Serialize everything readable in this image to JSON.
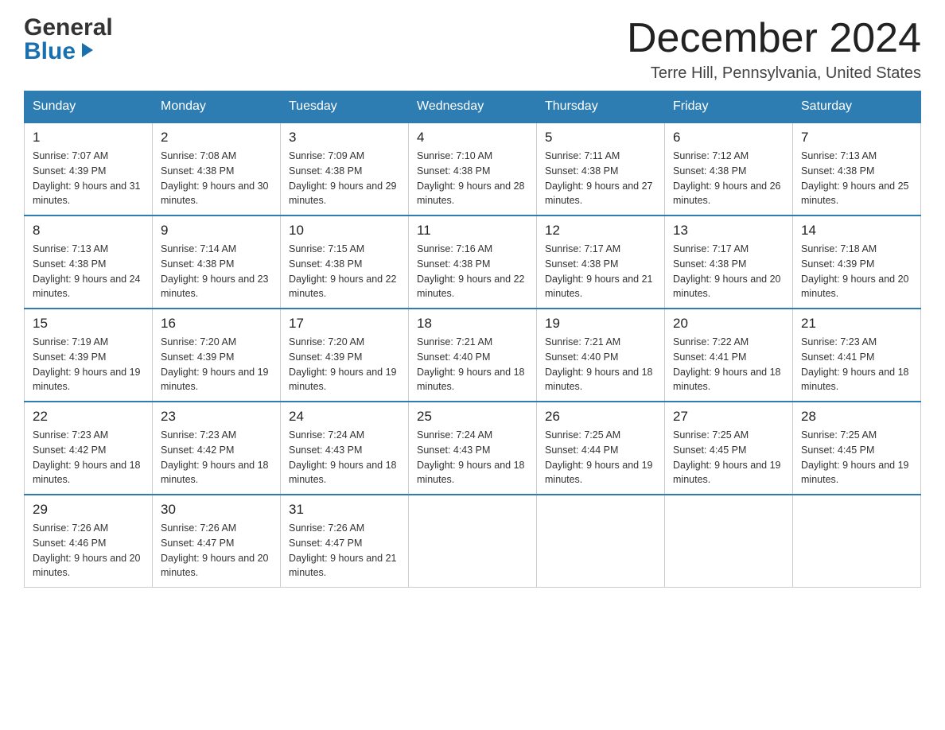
{
  "header": {
    "logo_line1": "General",
    "logo_line2": "Blue",
    "month_title": "December 2024",
    "location": "Terre Hill, Pennsylvania, United States"
  },
  "weekdays": [
    "Sunday",
    "Monday",
    "Tuesday",
    "Wednesday",
    "Thursday",
    "Friday",
    "Saturday"
  ],
  "weeks": [
    [
      {
        "day": "1",
        "sunrise": "Sunrise: 7:07 AM",
        "sunset": "Sunset: 4:39 PM",
        "daylight": "Daylight: 9 hours and 31 minutes."
      },
      {
        "day": "2",
        "sunrise": "Sunrise: 7:08 AM",
        "sunset": "Sunset: 4:38 PM",
        "daylight": "Daylight: 9 hours and 30 minutes."
      },
      {
        "day": "3",
        "sunrise": "Sunrise: 7:09 AM",
        "sunset": "Sunset: 4:38 PM",
        "daylight": "Daylight: 9 hours and 29 minutes."
      },
      {
        "day": "4",
        "sunrise": "Sunrise: 7:10 AM",
        "sunset": "Sunset: 4:38 PM",
        "daylight": "Daylight: 9 hours and 28 minutes."
      },
      {
        "day": "5",
        "sunrise": "Sunrise: 7:11 AM",
        "sunset": "Sunset: 4:38 PM",
        "daylight": "Daylight: 9 hours and 27 minutes."
      },
      {
        "day": "6",
        "sunrise": "Sunrise: 7:12 AM",
        "sunset": "Sunset: 4:38 PM",
        "daylight": "Daylight: 9 hours and 26 minutes."
      },
      {
        "day": "7",
        "sunrise": "Sunrise: 7:13 AM",
        "sunset": "Sunset: 4:38 PM",
        "daylight": "Daylight: 9 hours and 25 minutes."
      }
    ],
    [
      {
        "day": "8",
        "sunrise": "Sunrise: 7:13 AM",
        "sunset": "Sunset: 4:38 PM",
        "daylight": "Daylight: 9 hours and 24 minutes."
      },
      {
        "day": "9",
        "sunrise": "Sunrise: 7:14 AM",
        "sunset": "Sunset: 4:38 PM",
        "daylight": "Daylight: 9 hours and 23 minutes."
      },
      {
        "day": "10",
        "sunrise": "Sunrise: 7:15 AM",
        "sunset": "Sunset: 4:38 PM",
        "daylight": "Daylight: 9 hours and 22 minutes."
      },
      {
        "day": "11",
        "sunrise": "Sunrise: 7:16 AM",
        "sunset": "Sunset: 4:38 PM",
        "daylight": "Daylight: 9 hours and 22 minutes."
      },
      {
        "day": "12",
        "sunrise": "Sunrise: 7:17 AM",
        "sunset": "Sunset: 4:38 PM",
        "daylight": "Daylight: 9 hours and 21 minutes."
      },
      {
        "day": "13",
        "sunrise": "Sunrise: 7:17 AM",
        "sunset": "Sunset: 4:38 PM",
        "daylight": "Daylight: 9 hours and 20 minutes."
      },
      {
        "day": "14",
        "sunrise": "Sunrise: 7:18 AM",
        "sunset": "Sunset: 4:39 PM",
        "daylight": "Daylight: 9 hours and 20 minutes."
      }
    ],
    [
      {
        "day": "15",
        "sunrise": "Sunrise: 7:19 AM",
        "sunset": "Sunset: 4:39 PM",
        "daylight": "Daylight: 9 hours and 19 minutes."
      },
      {
        "day": "16",
        "sunrise": "Sunrise: 7:20 AM",
        "sunset": "Sunset: 4:39 PM",
        "daylight": "Daylight: 9 hours and 19 minutes."
      },
      {
        "day": "17",
        "sunrise": "Sunrise: 7:20 AM",
        "sunset": "Sunset: 4:39 PM",
        "daylight": "Daylight: 9 hours and 19 minutes."
      },
      {
        "day": "18",
        "sunrise": "Sunrise: 7:21 AM",
        "sunset": "Sunset: 4:40 PM",
        "daylight": "Daylight: 9 hours and 18 minutes."
      },
      {
        "day": "19",
        "sunrise": "Sunrise: 7:21 AM",
        "sunset": "Sunset: 4:40 PM",
        "daylight": "Daylight: 9 hours and 18 minutes."
      },
      {
        "day": "20",
        "sunrise": "Sunrise: 7:22 AM",
        "sunset": "Sunset: 4:41 PM",
        "daylight": "Daylight: 9 hours and 18 minutes."
      },
      {
        "day": "21",
        "sunrise": "Sunrise: 7:23 AM",
        "sunset": "Sunset: 4:41 PM",
        "daylight": "Daylight: 9 hours and 18 minutes."
      }
    ],
    [
      {
        "day": "22",
        "sunrise": "Sunrise: 7:23 AM",
        "sunset": "Sunset: 4:42 PM",
        "daylight": "Daylight: 9 hours and 18 minutes."
      },
      {
        "day": "23",
        "sunrise": "Sunrise: 7:23 AM",
        "sunset": "Sunset: 4:42 PM",
        "daylight": "Daylight: 9 hours and 18 minutes."
      },
      {
        "day": "24",
        "sunrise": "Sunrise: 7:24 AM",
        "sunset": "Sunset: 4:43 PM",
        "daylight": "Daylight: 9 hours and 18 minutes."
      },
      {
        "day": "25",
        "sunrise": "Sunrise: 7:24 AM",
        "sunset": "Sunset: 4:43 PM",
        "daylight": "Daylight: 9 hours and 18 minutes."
      },
      {
        "day": "26",
        "sunrise": "Sunrise: 7:25 AM",
        "sunset": "Sunset: 4:44 PM",
        "daylight": "Daylight: 9 hours and 19 minutes."
      },
      {
        "day": "27",
        "sunrise": "Sunrise: 7:25 AM",
        "sunset": "Sunset: 4:45 PM",
        "daylight": "Daylight: 9 hours and 19 minutes."
      },
      {
        "day": "28",
        "sunrise": "Sunrise: 7:25 AM",
        "sunset": "Sunset: 4:45 PM",
        "daylight": "Daylight: 9 hours and 19 minutes."
      }
    ],
    [
      {
        "day": "29",
        "sunrise": "Sunrise: 7:26 AM",
        "sunset": "Sunset: 4:46 PM",
        "daylight": "Daylight: 9 hours and 20 minutes."
      },
      {
        "day": "30",
        "sunrise": "Sunrise: 7:26 AM",
        "sunset": "Sunset: 4:47 PM",
        "daylight": "Daylight: 9 hours and 20 minutes."
      },
      {
        "day": "31",
        "sunrise": "Sunrise: 7:26 AM",
        "sunset": "Sunset: 4:47 PM",
        "daylight": "Daylight: 9 hours and 21 minutes."
      },
      null,
      null,
      null,
      null
    ]
  ]
}
